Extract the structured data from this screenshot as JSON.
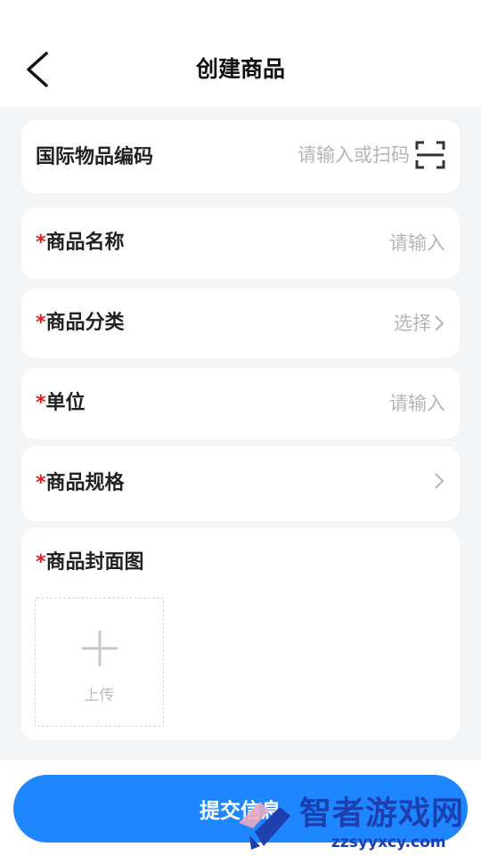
{
  "header": {
    "title": "创建商品"
  },
  "form": {
    "barcode": {
      "label": "国际物品编码",
      "placeholder": "请输入或扫码"
    },
    "name": {
      "required_mark": "*",
      "label": "商品名称",
      "placeholder": "请输入"
    },
    "category": {
      "required_mark": "*",
      "label": "商品分类",
      "value": "选择"
    },
    "unit": {
      "required_mark": "*",
      "label": "单位",
      "placeholder": "请输入"
    },
    "spec": {
      "required_mark": "*",
      "label": "商品规格"
    },
    "cover": {
      "required_mark": "*",
      "label": "商品封面图",
      "upload_label": "上传"
    }
  },
  "submit_label": "提交信息",
  "watermark": {
    "title": "智者游戏网",
    "url": "zzsyyxcy.com"
  },
  "colors": {
    "primary": "#1e86ff",
    "required": "#e51c1c",
    "background": "#f4f5f7"
  }
}
